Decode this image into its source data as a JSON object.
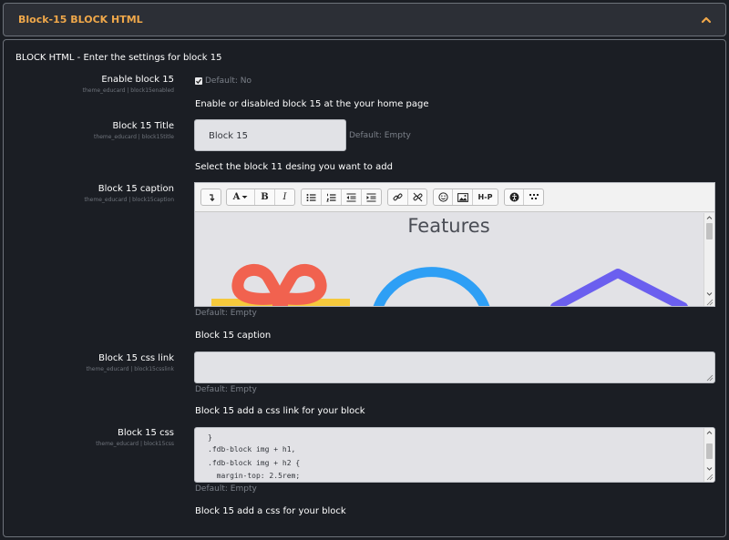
{
  "header": {
    "title": "Block-15 BLOCK HTML",
    "chevron_icon": "chevron-up-icon",
    "accent_color": "#f0a84a"
  },
  "panel": {
    "title": "BLOCK HTML - Enter the settings for block 15"
  },
  "settings": {
    "enable": {
      "label": "Enable block 15",
      "setting_id": "theme_educard | block15enabled",
      "checked": true,
      "default": "Default: No",
      "description": "Enable or disabled block 15 at the your home page"
    },
    "title": {
      "label": "Block 15 Title",
      "setting_id": "theme_educard | block15title",
      "value": "Block 15",
      "default": "Default: Empty",
      "description": "Select the block 11 desing you want to add"
    },
    "caption": {
      "label": "Block 15 caption",
      "setting_id": "theme_educard | block15caption",
      "editor_heading": "Features",
      "default": "Default: Empty",
      "description": "Block 15 caption",
      "toolbar_icons": [
        "show-more-buttons-icon",
        "font-color-icon",
        "bold-icon",
        "italic-icon",
        "unordered-list-icon",
        "ordered-list-icon",
        "outdent-icon",
        "indent-icon",
        "link-icon",
        "unlink-icon",
        "emoji-icon",
        "image-icon",
        "h5p-icon",
        "accessibility-checker-icon",
        "screenreader-helper-icon"
      ],
      "toolbar_labels": {
        "font": "A",
        "bold": "B",
        "italic": "I",
        "h5p": "H-P"
      }
    },
    "css_link": {
      "label": "Block 15 css link",
      "setting_id": "theme_educard | block15csslink",
      "value": "",
      "default": "Default: Empty",
      "description": "Block 15 add a css link for your block"
    },
    "css": {
      "label": "Block 15 css",
      "setting_id": "theme_educard | block15css",
      "code_lines": [
        "}",
        ".fdb-block img + h1,",
        ".fdb-block img + h2 {",
        "  margin-top: 2.5rem;"
      ],
      "default": "Default: Empty",
      "description": "Block 15 add a css for your block"
    }
  }
}
